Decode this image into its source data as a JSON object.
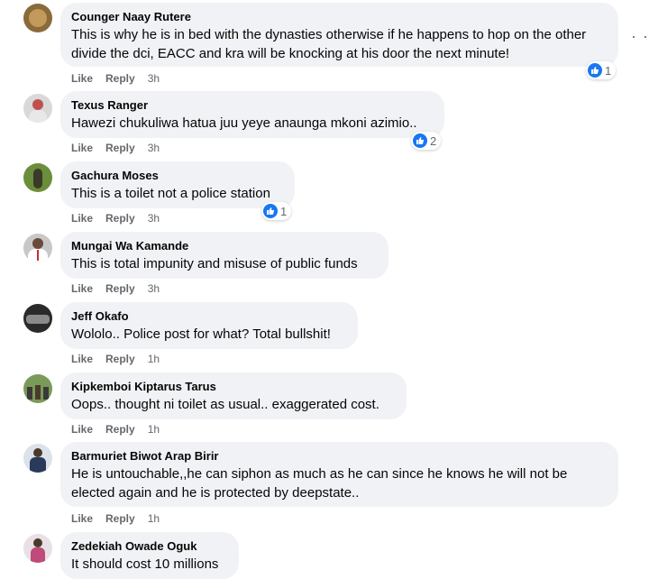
{
  "comments": [
    {
      "author": "Counger Naay Rutere",
      "text": "This is why he is in bed with the dynasties otherwise if he happens to hop on the other divide the dci, EACC and kra will be knocking at his door the next minute!",
      "like": "Like",
      "reply": "Reply",
      "time": "3h",
      "reactions": "1",
      "avatar_color": "#8a6a3a"
    },
    {
      "author": "Texus Ranger",
      "text": "Hawezi chukuliwa hatua juu yeye anaunga mkoni azimio..",
      "like": "Like",
      "reply": "Reply",
      "time": "3h",
      "reactions": "2",
      "avatar_color": "#c9c9c9"
    },
    {
      "author": "Gachura Moses",
      "text": "This is a toilet not a police station",
      "like": "Like",
      "reply": "Reply",
      "time": "3h",
      "reactions": "1",
      "avatar_color": "#6b8e3a"
    },
    {
      "author": "Mungai Wa Kamande",
      "text": "This is total impunity and misuse of public funds",
      "like": "Like",
      "reply": "Reply",
      "time": "3h",
      "avatar_color": "#7a5a4a"
    },
    {
      "author": "Jeff Okafo",
      "text": "Wololo.. Police post for what? Total bullshit!",
      "like": "Like",
      "reply": "Reply",
      "time": "1h",
      "avatar_color": "#3a3a3a"
    },
    {
      "author": "Kipkemboi Kiptarus Tarus",
      "text": "Oops.. thought ni toilet as usual.. exaggerated cost.",
      "like": "Like",
      "reply": "Reply",
      "time": "1h",
      "avatar_color": "#5a7a4a"
    },
    {
      "author": "Barmuriet Biwot Arap Birir",
      "text": "He is untouchable,,he can siphon as much as he can since he knows he will not be elected again and he is protected by deepstate..",
      "like": "Like",
      "reply": "Reply",
      "time": "1h",
      "avatar_color": "#3a4a6a"
    },
    {
      "author": "Zedekiah Owade Oguk",
      "text": "It should cost 10 millions",
      "avatar_color": "#b04a6a"
    }
  ],
  "more_options": "· ·"
}
